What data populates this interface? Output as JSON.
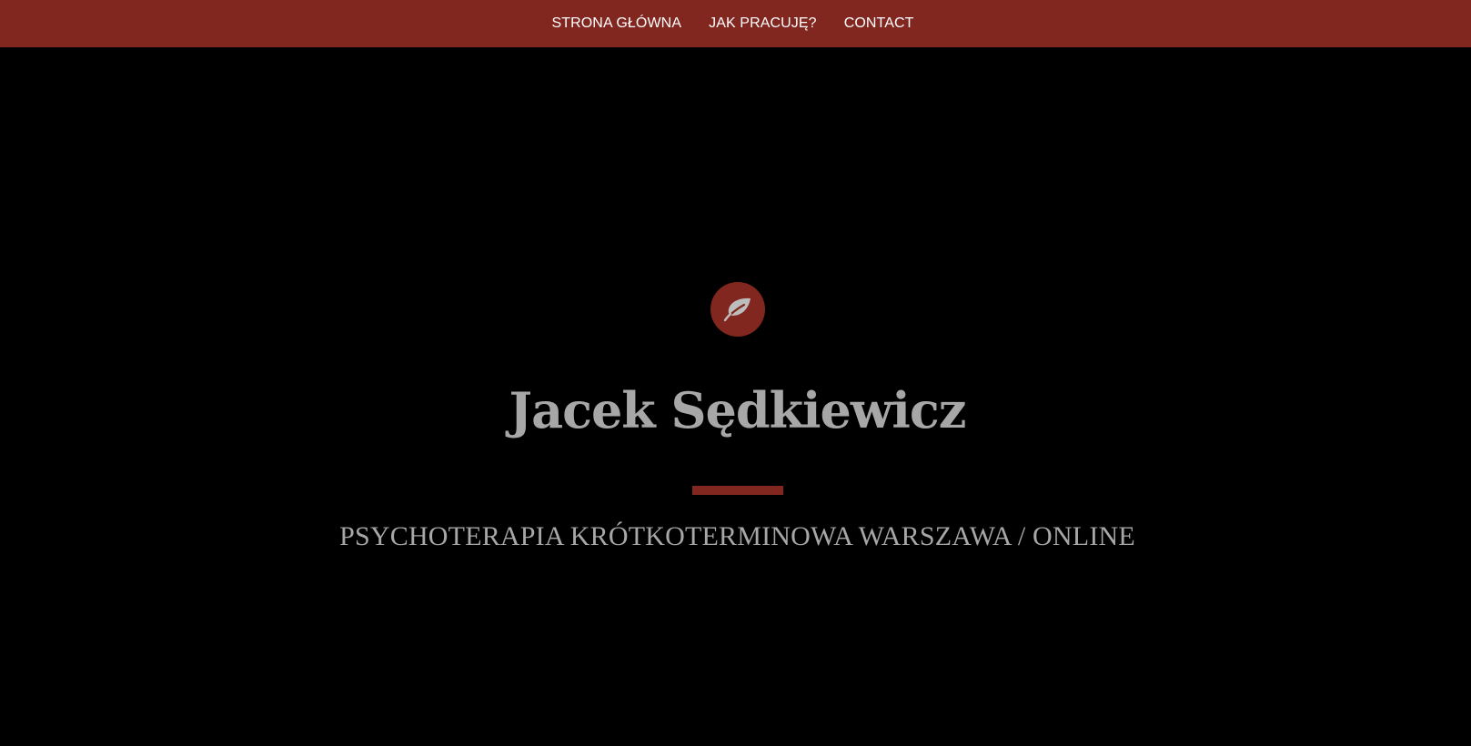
{
  "nav": {
    "items": [
      {
        "label": "STRONA GŁÓWNA"
      },
      {
        "label": "JAK PRACUJĘ?"
      },
      {
        "label": "CONTACT"
      }
    ]
  },
  "hero": {
    "icon": "leaf-icon",
    "title": "Jacek Sędkiewicz",
    "tagline": "PSYCHOTERAPIA KRÓTKOTERMINOWA WARSZAWA / ONLINE"
  },
  "colors": {
    "accent": "#822720",
    "background": "#000000",
    "text_muted": "#a7a7a7",
    "nav_text": "#ffffff"
  }
}
